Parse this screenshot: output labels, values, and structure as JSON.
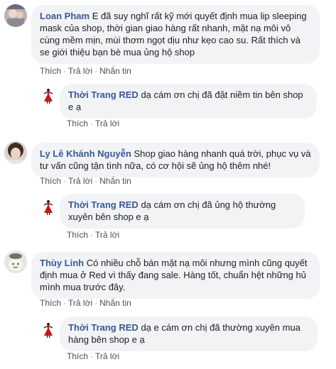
{
  "comments": [
    {
      "author": "Loan Pham",
      "text": "E đã suy nghĩ rất kỹ mới quyết định mua lip sleeping mask của shop, thời gian giao hàng rất nhanh, mặt nạ môi vô cùng mềm mịn, mùi thơm ngọt dịu như kẹo cao su. Rất thích và se giới thiệu bạn bè mua ủng hộ shop",
      "actions": [
        "Thích",
        "Trả lời",
        "Nhắn tin"
      ],
      "reply": {
        "author": "Thời Trang RED",
        "text": "dạ cám ơn chị đã đặt niềm tin bên shop e ạ",
        "actions": [
          "Thích",
          "Trả lời"
        ]
      }
    },
    {
      "author": "Ly Lê Khánh Nguyễn",
      "text": "Shop giao hàng nhanh quá trời, phục vụ và tư vấn cũng tận tình nữa, có cơ hội sẽ ủng hộ thêm nhé!",
      "actions": [
        "Thích",
        "Trả lời",
        "Nhắn tin"
      ],
      "reply": {
        "author": "Thời Trang RED",
        "text": "dạ cám ơn chị đã ủng hộ thường xuyên bên shop e ạ",
        "actions": [
          "Thích",
          "Trả lời"
        ]
      }
    },
    {
      "author": "Thùy Linh",
      "text": "Có nhiều chỗ bán mặt nạ môi nhưng mình cũng quyết định mua ở Red vì thấy đang sale. Hàng tốt, chuẩn hệt những hủ mình mua trước đây.",
      "actions": [
        "Thích",
        "Trả lời",
        "Nhắn tin"
      ],
      "reply": {
        "author": "Thời Trang RED",
        "text": "dạ e cám ơn chị đã thường xuyên mua hàng bên shop e ạ",
        "actions": [
          "Thích",
          "Trả lời"
        ]
      }
    }
  ],
  "separator": "·",
  "colors": {
    "author": "#385898",
    "bubble": "#f2f3f5",
    "action": "#4b4f56",
    "brand_red": "#c4161c"
  }
}
